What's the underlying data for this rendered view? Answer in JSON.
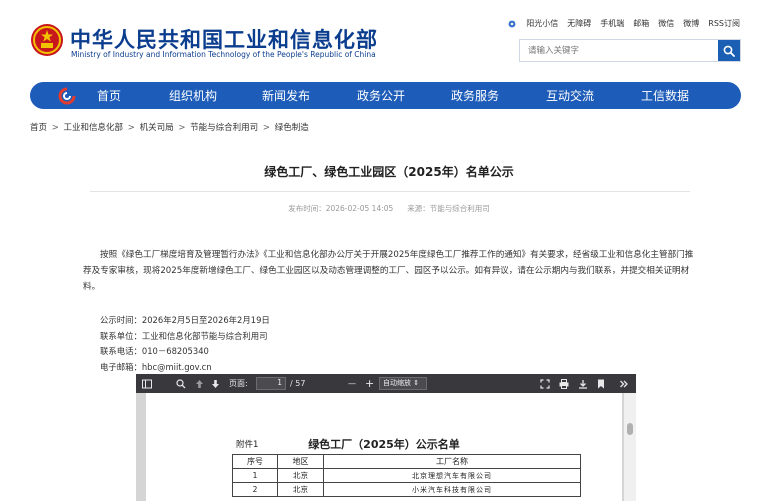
{
  "header": {
    "site_name": "中华人民共和国工业和信息化部",
    "site_name_en": "Ministry of Industry and Information Technology of the People's Republic of China",
    "top_links": [
      "阳光小信",
      "无障碍",
      "手机端",
      "邮箱",
      "微信",
      "微博",
      "RSS订阅"
    ],
    "search_placeholder": "请输入关键字"
  },
  "nav": {
    "items": [
      "首页",
      "组织机构",
      "新闻发布",
      "政务公开",
      "政务服务",
      "互动交流",
      "工信数据"
    ]
  },
  "breadcrumb": [
    "首页",
    "工业和信息化部",
    "机关司局",
    "节能与综合利用司",
    "绿色制造"
  ],
  "breadcrumb_sep": ">",
  "article": {
    "title": "绿色工厂、绿色工业园区（2025年）名单公示",
    "published": "发布时间：2026-02-05 14:05",
    "source": "来源：节能与综合利用司",
    "body": "按照《绿色工厂梯度培育及管理暂行办法》《工业和信息化部办公厅关于开展2025年度绿色工厂推荐工作的通知》有关要求，经省级工业和信息化主管部门推荐及专家审核，现将2025年度新增绿色工厂、绿色工业园区以及动态管理调整的工厂、园区予以公示。如有异议，请在公示期内与我们联系，并提交相关证明材料。",
    "info": [
      "公示时间：2026年2月5日至2026年2月19日",
      "联系单位：工业和信息化部节能与综合利用司",
      "联系电话：010－68205340",
      "电子邮箱：hbc@miit.gov.cn"
    ]
  },
  "pdf_viewer": {
    "page_label": "页面:",
    "page_current": "1",
    "page_total": "/ 57",
    "zoom_value": "自动缩放",
    "minus_label": "—",
    "plus_label": "+",
    "document": {
      "attachment": "附件1",
      "title": "绿色工厂（2025年）公示名单",
      "headers": [
        "序号",
        "地区",
        "工厂名称"
      ],
      "rows": [
        [
          "1",
          "北京",
          "北京理想汽车有限公司"
        ],
        [
          "2",
          "北京",
          "小米汽车科技有限公司"
        ]
      ]
    }
  },
  "colors": {
    "brand_blue": "#1d5cb8",
    "title_blue": "#0b3d8f",
    "pdf_toolbar": "#38383d"
  }
}
